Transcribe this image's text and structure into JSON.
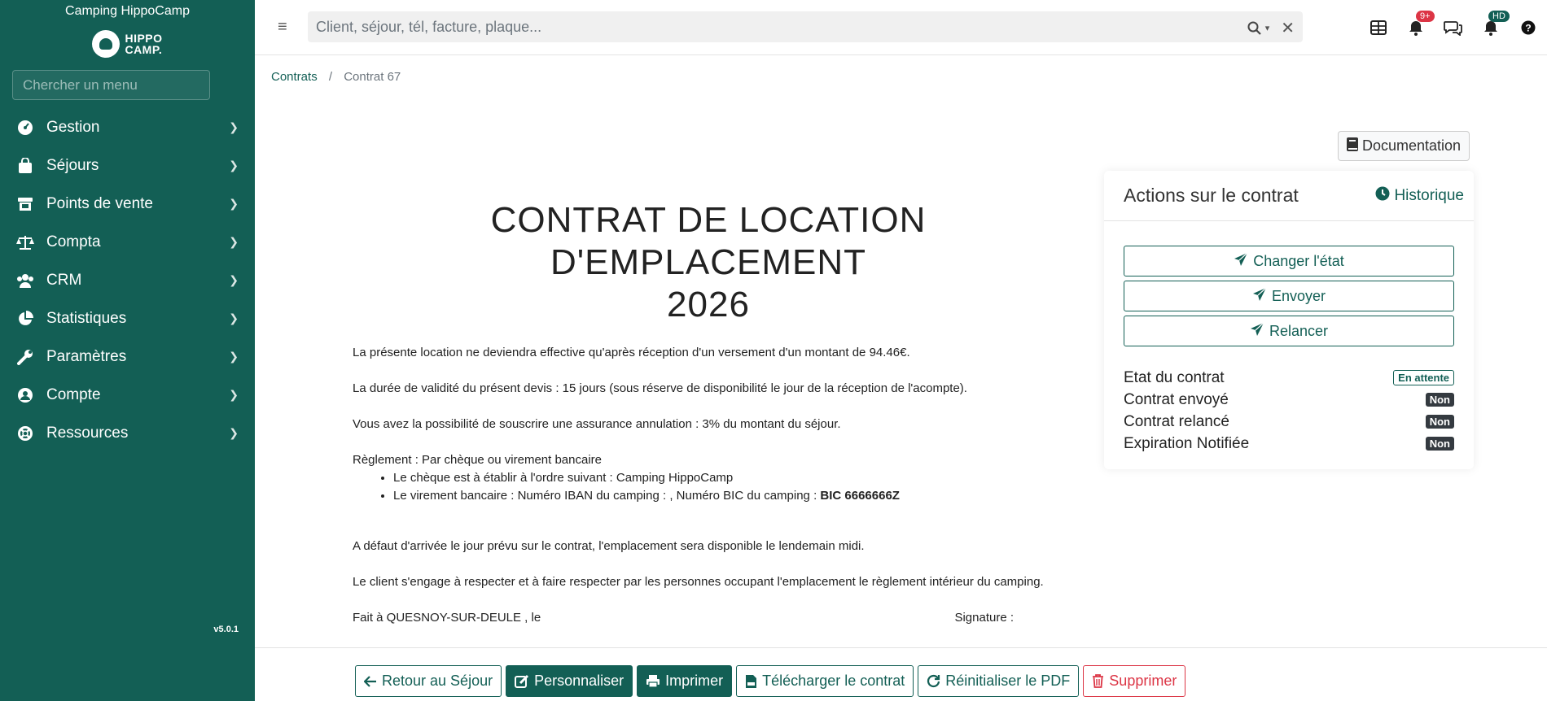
{
  "sidebar": {
    "camping_name": "Camping HippoCamp",
    "logo_text_1": "HIPPO",
    "logo_text_2": "CAMP.",
    "search_placeholder": "Chercher un menu",
    "items": [
      {
        "label": "Gestion",
        "icon": "dashboard-icon"
      },
      {
        "label": "Séjours",
        "icon": "shopping-bag-icon"
      },
      {
        "label": "Points de vente",
        "icon": "store-icon"
      },
      {
        "label": "Compta",
        "icon": "scale-icon"
      },
      {
        "label": "CRM",
        "icon": "users-icon"
      },
      {
        "label": "Statistiques",
        "icon": "chart-pie-icon"
      },
      {
        "label": "Paramètres",
        "icon": "wrench-icon"
      },
      {
        "label": "Compte",
        "icon": "user-circle-icon"
      },
      {
        "label": "Ressources",
        "icon": "life-ring-icon"
      }
    ],
    "version": "v5.0.1"
  },
  "topbar": {
    "search_placeholder": "Client, séjour, tél, facture, plaque...",
    "notification_badge": "9+",
    "user_badge": "HD"
  },
  "breadcrumb": {
    "parent": "Contrats",
    "current": "Contrat 67"
  },
  "doc_button": "Documentation",
  "contract": {
    "title_line1": "CONTRAT DE LOCATION D'EMPLACEMENT",
    "title_line2": "2026",
    "p1": "La présente location ne deviendra effective qu'après réception d'un versement d'un montant de 94.46€.",
    "p2": "La durée de validité du présent devis : 15 jours (sous réserve de disponibilité le jour de la réception de l'acompte).",
    "p3": "Vous avez la possibilité de souscrire une assurance annulation : 3% du montant du séjour.",
    "reglement": "Règlement : Par chèque ou virement bancaire",
    "bullet1": "Le chèque est à établir à l'ordre suivant : Camping HippoCamp",
    "bullet2_prefix": "Le virement bancaire : Numéro IBAN du camping :  ,  Numéro BIC du camping : ",
    "bullet2_bic": "BIC 6666666Z",
    "p4": "A défaut d'arrivée le jour prévu sur le contrat, l'emplacement sera disponible le lendemain midi.",
    "p5": "Le client s'engage à respecter et à faire respecter par les personnes occupant l'emplacement le règlement intérieur du camping.",
    "fait_a": "Fait à QUESNOY-SUR-DEULE , le",
    "signature": "Signature :"
  },
  "actions": {
    "title": "Actions sur le contrat",
    "history": "Historique",
    "buttons": [
      "Changer l'état",
      "Envoyer",
      "Relancer"
    ],
    "status": [
      {
        "label": "Etat du contrat",
        "value": "En attente"
      },
      {
        "label": "Contrat envoyé",
        "value": "Non"
      },
      {
        "label": "Contrat relancé",
        "value": "Non"
      },
      {
        "label": "Expiration Notifiée",
        "value": "Non"
      }
    ]
  },
  "bottom": {
    "back": "Retour au Séjour",
    "customize": "Personnaliser",
    "print": "Imprimer",
    "download": "Télécharger le contrat",
    "reset": "Réinitialiser le PDF",
    "delete": "Supprimer"
  },
  "colors": {
    "primary": "#135f55",
    "danger": "#dc3545",
    "dark_badge": "#343a40"
  }
}
